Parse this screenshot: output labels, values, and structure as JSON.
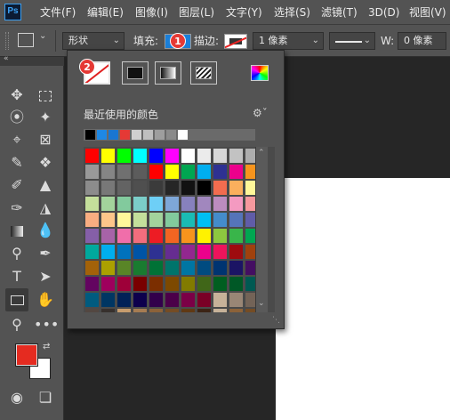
{
  "app": {
    "logo_text": "Ps"
  },
  "menu": [
    "文件(F)",
    "编辑(E)",
    "图像(I)",
    "图层(L)",
    "文字(Y)",
    "选择(S)",
    "滤镜(T)",
    "3D(D)",
    "视图(V)"
  ],
  "options": {
    "mode_value": "形状",
    "fill_label": "填充:",
    "stroke_label": "描边:",
    "stroke_width": "1 像素",
    "w_label": "W:",
    "w_value": "0 像素"
  },
  "badges": {
    "one": "1",
    "two": "2"
  },
  "popup": {
    "recent_label": "最近使用的颜色",
    "recent_colors": [
      "#000000",
      "#1e88e5",
      "#1976d2",
      "#e53935",
      "#d0d0d0",
      "#bfbfbf",
      "#9e9e9e",
      "#8a8a8a",
      "#ffffff"
    ],
    "swatch_rows": [
      [
        "#ff0000",
        "#ffff00",
        "#00ff00",
        "#00ffff",
        "#0000ff",
        "#ff00ff",
        "#ffffff",
        "#ebebeb",
        "#d6d6d6",
        "#c2c2c2",
        "#adadad"
      ],
      [
        "#999999",
        "#858585",
        "#707070",
        "#5c5c5c",
        "#ff0000",
        "#ffff00",
        "#00a651",
        "#00aeef",
        "#2e3192",
        "#ec008c",
        "#f7941d"
      ],
      [
        "#8c8c8c",
        "#787878",
        "#636363",
        "#4f4f4f",
        "#3b3b3b",
        "#262626",
        "#121212",
        "#000000",
        "#f26c4f",
        "#fbaf5d",
        "#fff799"
      ],
      [
        "#c4df9b",
        "#a3d39c",
        "#82ca9d",
        "#7bcdc8",
        "#6ecff6",
        "#7ea7d8",
        "#8781bd",
        "#a187be",
        "#bc8cbf",
        "#f49ac1",
        "#f6989d"
      ],
      [
        "#f9ad81",
        "#fdc68a",
        "#fff79a",
        "#c4df9b",
        "#a3d39c",
        "#82ca9d",
        "#1abbb4",
        "#00bff3",
        "#448ccb",
        "#5574b9",
        "#605ca8"
      ],
      [
        "#855fa8",
        "#a763a8",
        "#f06eaa",
        "#f26d7d",
        "#ed1c24",
        "#f26522",
        "#f7941d",
        "#fff200",
        "#8dc73f",
        "#39b54a",
        "#00a651"
      ],
      [
        "#00a99d",
        "#00aeef",
        "#0072bc",
        "#0054a6",
        "#2e3192",
        "#662d91",
        "#92278f",
        "#ec008c",
        "#ed145b",
        "#9e0b0f",
        "#a0410d"
      ],
      [
        "#a36209",
        "#aba000",
        "#598527",
        "#197b30",
        "#007236",
        "#00746b",
        "#0076a3",
        "#004b80",
        "#003471",
        "#1b1464",
        "#440e62"
      ],
      [
        "#630460",
        "#9e005d",
        "#9e0039",
        "#790000",
        "#7b2e00",
        "#7d4900",
        "#827b00",
        "#406618",
        "#005e20",
        "#005826",
        "#005952"
      ],
      [
        "#005b7f",
        "#003663",
        "#002157",
        "#0d004c",
        "#32004b",
        "#4b0049",
        "#7b0046",
        "#7a0026",
        "#c7b299",
        "#998675",
        "#736357"
      ],
      [
        "#534741",
        "#37302d",
        "#c69c6d",
        "#a67c52",
        "#8c6239",
        "#754c24",
        "#603913",
        "#3c2415",
        "#c7b299",
        "#8c6239",
        "#754c24"
      ]
    ]
  },
  "tools": [
    "move-tool",
    "marquee-tool",
    "lasso-tool",
    "magic-wand-tool",
    "crop-tool",
    "frame-tool",
    "eyedropper-tool",
    "healing-brush-tool",
    "brush-tool",
    "stamp-tool",
    "history-brush-tool",
    "eraser-tool",
    "gradient-tool",
    "blur-tool",
    "dodge-tool",
    "pen-tool",
    "type-tool",
    "path-selection-tool",
    "rectangle-tool",
    "hand-tool",
    "zoom-tool",
    "more-tools"
  ],
  "colors": {
    "foreground": "#e52b20",
    "background": "#ffffff",
    "fill": "#1b7fd8"
  }
}
